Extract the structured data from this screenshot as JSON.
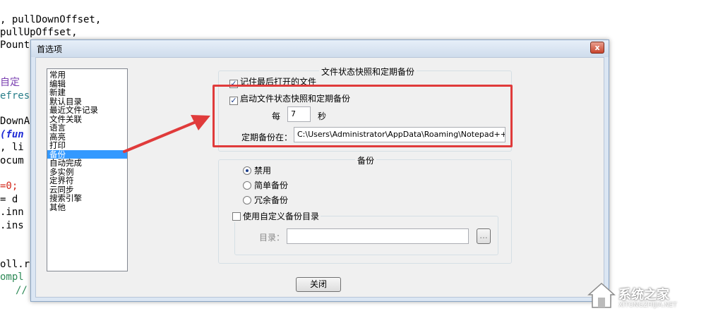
{
  "editor": {
    "lines": [
      ", pullDownOffset,",
      "pullUpOffset,",
      "Pount",
      "自定",
      "efres",
      "DownA",
      "(fun",
      ", li",
      "ocum",
      "=0;",
      "= d",
      ".inn",
      ".ins",
      "oll.r",
      "ompl",
      "//"
    ]
  },
  "dialog": {
    "title": "首选项",
    "close_glyph": "x",
    "nav_items": [
      "常用",
      "编辑",
      "新建",
      "默认目录",
      "最近文件记录",
      "文件关联",
      "语言",
      "高亮",
      "打印",
      "备份",
      "自动完成",
      "多实例",
      "定界符",
      "云同步",
      "搜索引擎",
      "其他"
    ],
    "selected_index": 9,
    "snapshot_group": {
      "label": "文件状态快照和定期备份",
      "remember_last": "记住最后打开的文件",
      "enable_snapshot": "启动文件状态快照和定期备份",
      "every_label": "每",
      "interval_value": "7",
      "seconds_label": "秒",
      "backup_path_label": "定期备份在：",
      "backup_path_value": "C:\\Users\\Administrator\\AppData\\Roaming\\Notepad++\\backup\\"
    },
    "backup_group": {
      "label": "备份",
      "options": [
        "禁用",
        "简单备份",
        "冗余备份"
      ],
      "selected_option": 0,
      "custom_dir_label": "使用自定义备份目录",
      "dir_label": "目录：",
      "dir_value": "",
      "browse_label": "..."
    },
    "close_button": "关闭"
  },
  "colors": {
    "annotation": "#e03b3b",
    "selection": "#3399ff"
  },
  "watermark": {
    "text": "系统之家",
    "sub": "XITONGZHIJIA.NET"
  }
}
